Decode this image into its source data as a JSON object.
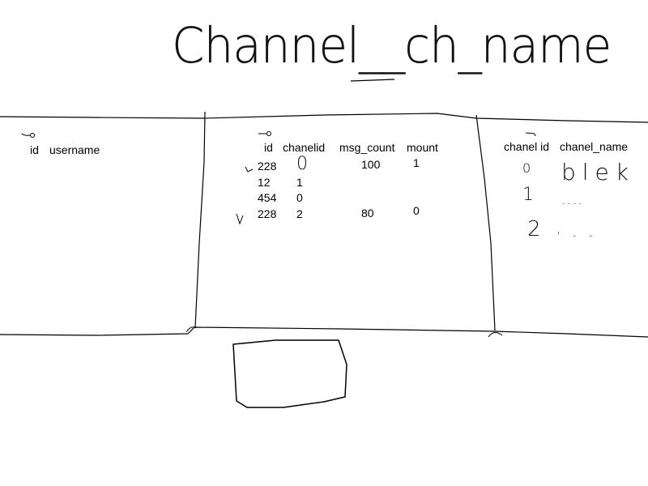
{
  "title": "Channel__ch_name",
  "tables": {
    "users": {
      "columns": [
        "id",
        "username"
      ],
      "key_icon": "key-icon"
    },
    "messages": {
      "columns": [
        "id",
        "chanelid",
        "msg_count",
        "mount"
      ],
      "key_icon": "key-icon",
      "rows": [
        {
          "id": "228",
          "chanelid": "0",
          "msg_count": "100",
          "mount": "1",
          "mark": "v"
        },
        {
          "id": "12",
          "chanelid": "1",
          "msg_count": "",
          "mount": ""
        },
        {
          "id": "454",
          "chanelid": "0",
          "msg_count": "",
          "mount": ""
        },
        {
          "id": "228",
          "chanelid": "2",
          "msg_count": "80",
          "mount": "0",
          "mark": "V"
        }
      ]
    },
    "channels": {
      "columns": [
        "chanel id",
        "chanel_name"
      ],
      "key_icon": "key-icon",
      "rows": [
        {
          "chanel_id": "0",
          "chanel_name": "blek"
        },
        {
          "chanel_id": "1",
          "chanel_name": "- - - -"
        },
        {
          "chanel_id": "2",
          "chanel_name": "' - -"
        }
      ]
    }
  }
}
